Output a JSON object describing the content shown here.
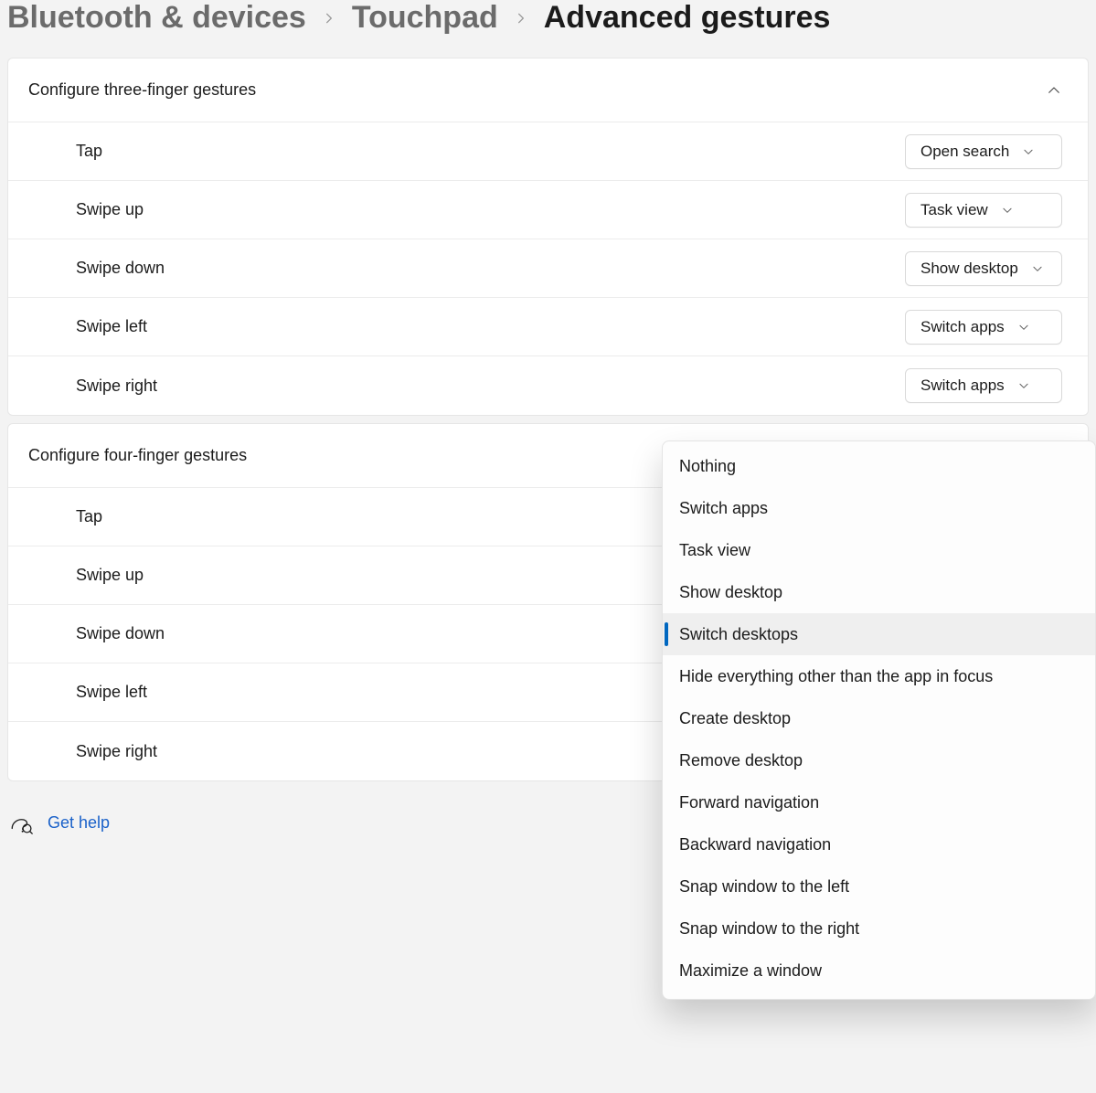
{
  "breadcrumb": {
    "level1": "Bluetooth & devices",
    "level2": "Touchpad",
    "current": "Advanced gestures"
  },
  "sections": {
    "three": {
      "title": "Configure three-finger gestures",
      "rows": [
        {
          "label": "Tap",
          "value": "Open search"
        },
        {
          "label": "Swipe up",
          "value": "Task view"
        },
        {
          "label": "Swipe down",
          "value": "Show desktop"
        },
        {
          "label": "Swipe left",
          "value": "Switch apps"
        },
        {
          "label": "Swipe right",
          "value": "Switch apps"
        }
      ]
    },
    "four": {
      "title": "Configure four-finger gestures",
      "rows": [
        {
          "label": "Tap"
        },
        {
          "label": "Swipe up"
        },
        {
          "label": "Swipe down"
        },
        {
          "label": "Swipe left"
        },
        {
          "label": "Swipe right"
        }
      ]
    }
  },
  "dropdown": {
    "selected_index": 4,
    "items": [
      "Nothing",
      "Switch apps",
      "Task view",
      "Show desktop",
      "Switch desktops",
      "Hide everything other than the app in focus",
      "Create desktop",
      "Remove desktop",
      "Forward navigation",
      "Backward navigation",
      "Snap window to the left",
      "Snap window to the right",
      "Maximize a window"
    ]
  },
  "help": {
    "label": "Get help"
  }
}
